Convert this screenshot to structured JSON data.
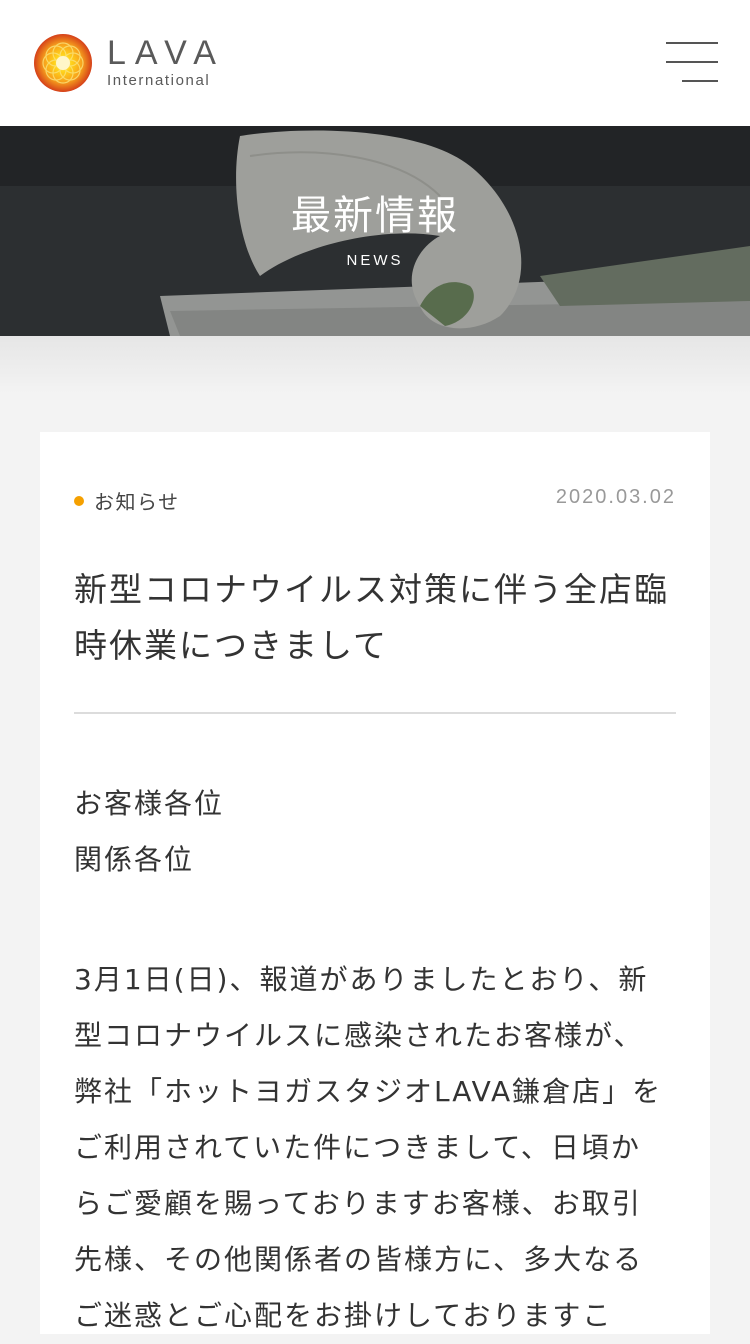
{
  "header": {
    "logo": {
      "main": "LAVA",
      "sub": "International",
      "icon": "lava-sun-logo-icon"
    },
    "menu": {
      "icon": "hamburger-menu-icon"
    }
  },
  "hero": {
    "title": "最新情報",
    "subtitle": "NEWS"
  },
  "article": {
    "category": "お知らせ",
    "category_color": "#f5a000",
    "date": "2020.03.02",
    "title_lines": [
      "新型コロナウイルス対策に伴う全店臨",
      "時休業につきまして"
    ],
    "greeting": [
      "お客様各位",
      "関係各位"
    ],
    "body_lines": [
      "3月1日(日)、報道がありましたとおり、新",
      "型コロナウイルスに感染されたお客様が、",
      "弊社「ホットヨガスタジオLAVA鎌倉店」を",
      "ご利用されていた件につきまして、日頃か",
      "らご愛顧を賜っておりますお客様、お取引",
      "先様、その他関係者の皆様方に、多大なる",
      "ご迷惑とご心配をお掛けしておりますこ"
    ]
  }
}
